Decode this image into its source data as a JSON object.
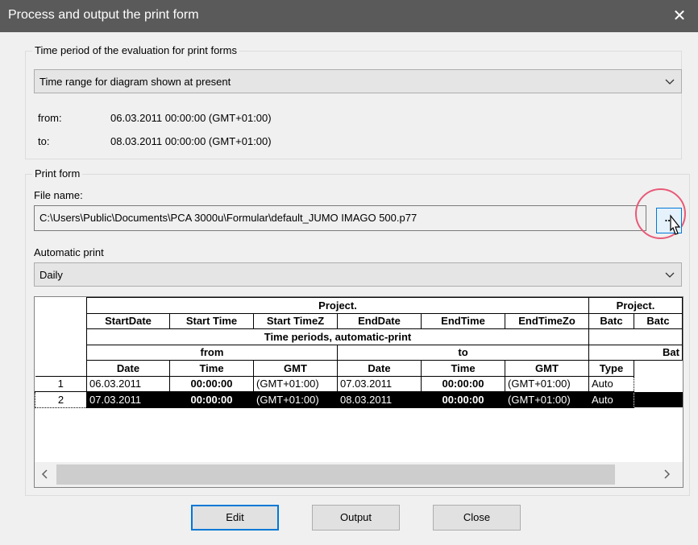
{
  "window": {
    "title": "Process and output the print form",
    "close_glyph": "✕"
  },
  "time_period": {
    "legend": "Time period of the evaluation for print forms",
    "combo_value": "Time range for diagram shown at present",
    "from_label": "from:",
    "from_value": "06.03.2011 00:00:00 (GMT+01:00)",
    "to_label": "to:",
    "to_value": "08.03.2011 00:00:00 (GMT+01:00)"
  },
  "print_form": {
    "legend": "Print form",
    "file_label": "File name:",
    "file_value": "C:\\Users\\Public\\Documents\\PCA 3000u\\Formular\\default_JUMO IMAGO 500.p77",
    "browse_label": "...",
    "auto_label": "Automatic print",
    "auto_value": "Daily"
  },
  "grid": {
    "h1": [
      "Project.",
      "Project."
    ],
    "h2": [
      "StartDate",
      "Start Time",
      "Start TimeZ",
      "EndDate",
      "EndTime",
      "EndTimeZo",
      "Batc",
      "Batc"
    ],
    "h3": "Time periods, automatic-print",
    "h4": [
      "from",
      "to",
      "Bat"
    ],
    "h5": [
      "Date",
      "Time",
      "GMT",
      "Date",
      "Time",
      "GMT",
      "Type"
    ],
    "rows": [
      {
        "num": "1",
        "cells": [
          "06.03.2011",
          "00:00:00",
          "(GMT+01:00)",
          "07.03.2011",
          "00:00:00",
          "(GMT+01:00)",
          "Auto"
        ]
      },
      {
        "num": "2",
        "cells": [
          "07.03.2011",
          "00:00:00",
          "(GMT+01:00)",
          "08.03.2011",
          "00:00:00",
          "(GMT+01:00)",
          "Auto"
        ]
      }
    ]
  },
  "buttons": {
    "edit": "Edit",
    "output": "Output",
    "close": "Close"
  },
  "icons": {
    "chevron": "chevron-down-icon",
    "scroll_left": "‹",
    "scroll_right": "›"
  },
  "colors": {
    "titlebar": "#5a5a5a",
    "accent": "#0078d7",
    "highlight": "#e85a78"
  }
}
